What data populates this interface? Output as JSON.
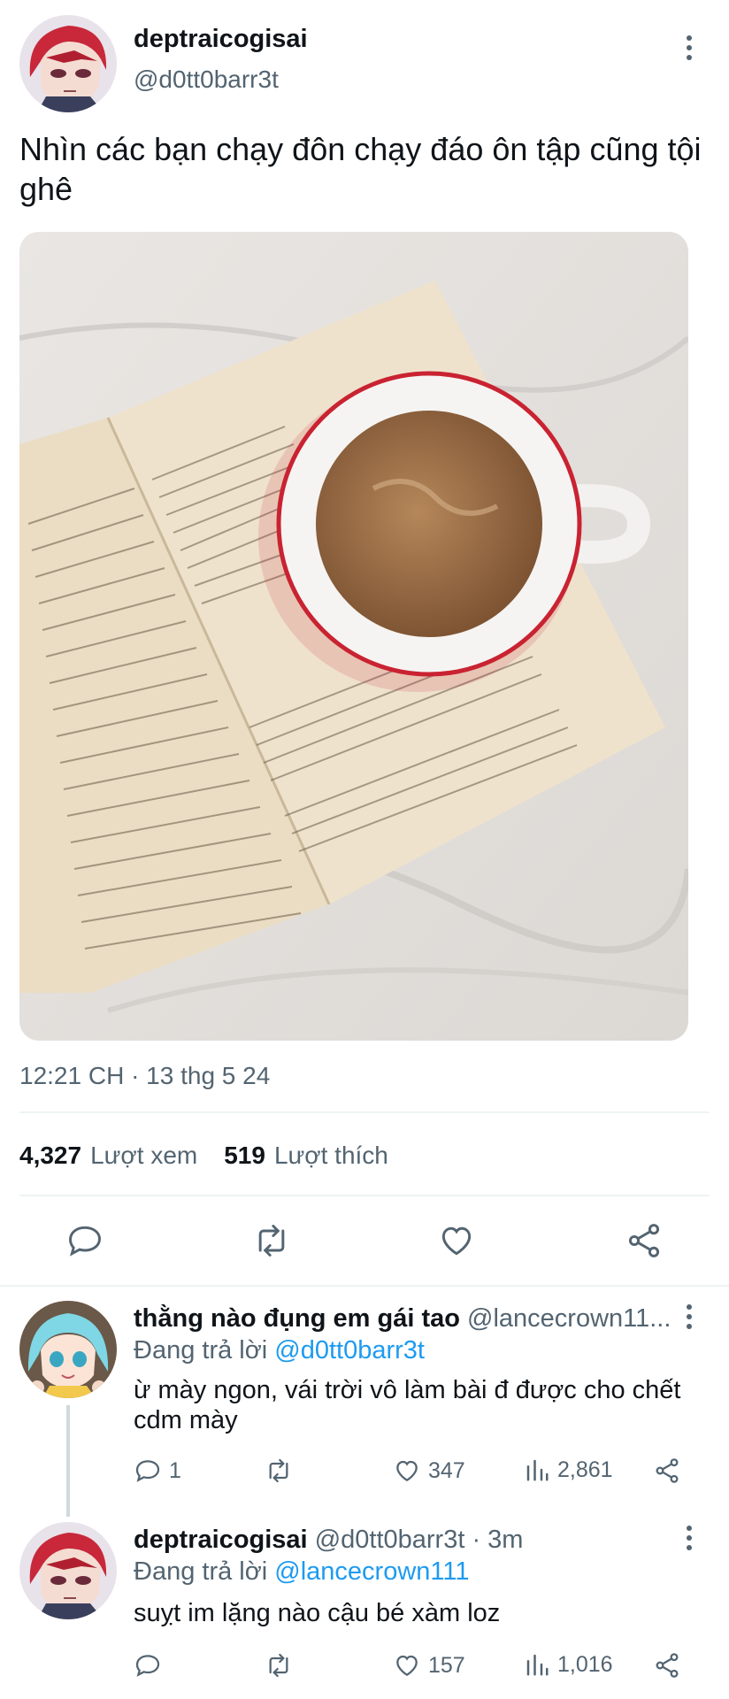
{
  "tweet": {
    "display_name": "deptraicogisai",
    "handle": "@d0tt0barr3t",
    "text": "Nhìn các bạn chạy đôn chạy đáo ôn tập cũng tội ghê",
    "image": {
      "content": "photo-open-book-with-coffee-cup"
    },
    "timestamp": "12:21 CH · 13 thg 5 24",
    "views_count": "4,327",
    "views_label": "Lượt xem",
    "likes_count": "519",
    "likes_label": "Lượt thích",
    "actions": [
      "reply-icon",
      "retweet-icon",
      "like-icon",
      "share-icon"
    ]
  },
  "replies": [
    {
      "display_name": "thằng nào đụng em gái tao",
      "handle": "@lancecrown11...",
      "replying_prefix": "Đang trả lời",
      "replying_to": "@d0tt0barr3t",
      "text": "ừ mày ngon, vái trời vô làm bài đ được cho chết cdm mày",
      "reply_count": "1",
      "retweet_count": "",
      "like_count": "347",
      "view_count": "2,861"
    },
    {
      "display_name": "deptraicogisai",
      "handle": "@d0tt0barr3t · 3m",
      "replying_prefix": "Đang trả lời",
      "replying_to": "@lancecrown111",
      "text": "suỵt im lặng nào cậu bé xàm loz",
      "reply_count": "",
      "retweet_count": "",
      "like_count": "157",
      "view_count": "1,016"
    }
  ],
  "colors": {
    "text": "#0f1419",
    "secondary": "#536471",
    "link": "#1d9bf0",
    "divider": "#eff3f4"
  }
}
